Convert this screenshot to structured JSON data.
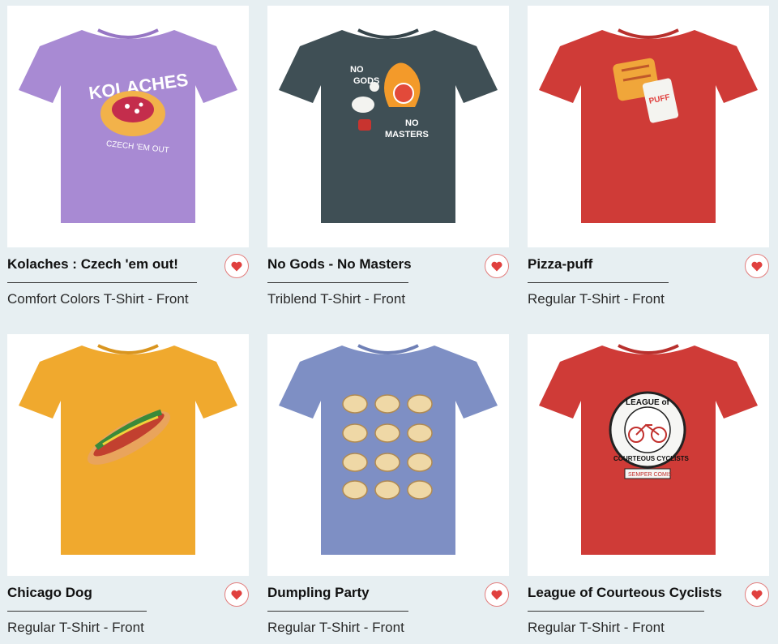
{
  "products": [
    {
      "title": "Kolaches : Czech 'em out!",
      "subtitle": "Comfort Colors T-Shirt - Front",
      "shirt_color": "#a88ad3",
      "art_text": [
        "KOLACHES",
        "CZECH 'EM OUT"
      ]
    },
    {
      "title": "No Gods - No Masters",
      "subtitle": "Triblend T-Shirt - Front",
      "shirt_color": "#3f4f55",
      "art_text": [
        "NO",
        "GODS",
        "NO",
        "MASTERS"
      ]
    },
    {
      "title": "Pizza-puff",
      "subtitle": "Regular T-Shirt - Front",
      "shirt_color": "#cf3b37",
      "art_text": [
        "PUFF"
      ]
    },
    {
      "title": "Chicago Dog",
      "subtitle": "Regular T-Shirt - Front",
      "shirt_color": "#f0a92e",
      "art_text": []
    },
    {
      "title": "Dumpling Party",
      "subtitle": "Regular T-Shirt - Front",
      "shirt_color": "#7e8fc4",
      "art_text": []
    },
    {
      "title": "League of Courteous Cyclists",
      "subtitle": "Regular T-Shirt - Front",
      "shirt_color": "#cf3b37",
      "art_text": [
        "LEAGUE of",
        "COURTEOUS CYCLISTS",
        "SEMPER COMIS"
      ]
    }
  ],
  "heart_color": "#e0403e"
}
